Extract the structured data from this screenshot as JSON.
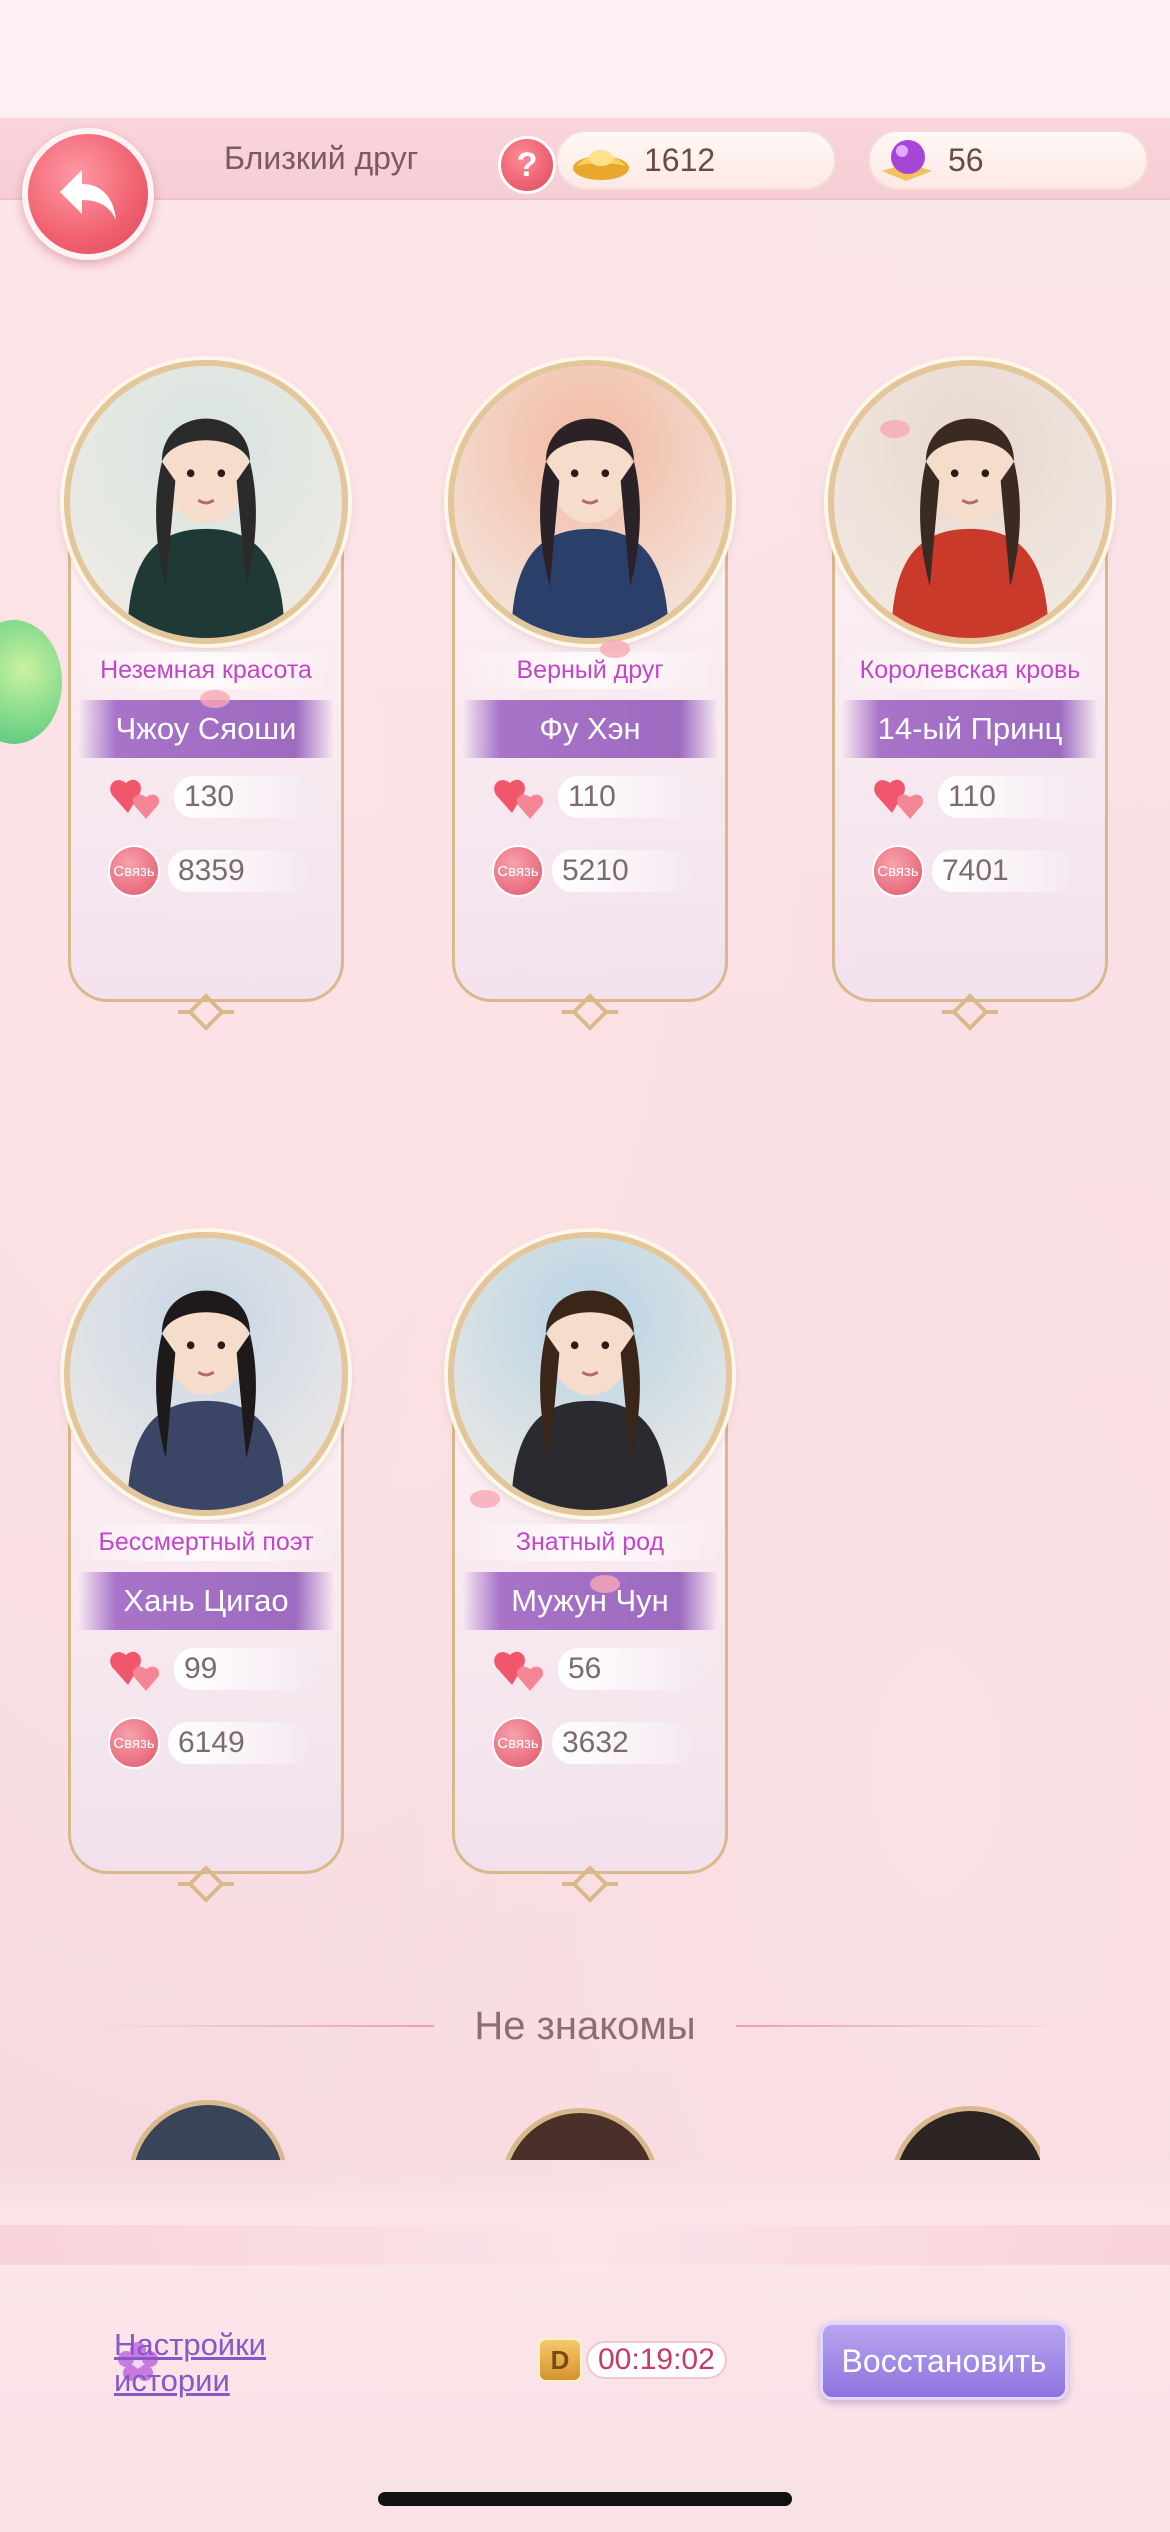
{
  "header": {
    "title": "Близкий друг",
    "help": "?",
    "gold": "1612",
    "gems": "56"
  },
  "cards": [
    {
      "title": "Неземная красота",
      "name": "Чжоу Сяоши",
      "hearts": "130",
      "bond_label": "Связь",
      "bond": "8359"
    },
    {
      "title": "Верный друг",
      "name": "Фу Хэн",
      "hearts": "110",
      "bond_label": "Связь",
      "bond": "5210"
    },
    {
      "title": "Королевская кровь",
      "name": "14-ый Принц",
      "hearts": "110",
      "bond_label": "Связь",
      "bond": "7401"
    },
    {
      "title": "Бессмертный поэт",
      "name": "Хань Цигао",
      "hearts": "99",
      "bond_label": "Связь",
      "bond": "6149"
    },
    {
      "title": "Знатный род",
      "name": "Мужун Чун",
      "hearts": "56",
      "bond_label": "Связь",
      "bond": "3632"
    }
  ],
  "section": {
    "title": "Не знакомы"
  },
  "footer": {
    "settings_line1": "Настройки",
    "settings_line2": "истории",
    "timer_icon": "D",
    "timer": "00:19:02",
    "restore": "Восстановить"
  },
  "colors": {
    "accent_purple": "#9c6bc0",
    "title_pink": "#c247c8",
    "back_red": "#f0606f"
  }
}
